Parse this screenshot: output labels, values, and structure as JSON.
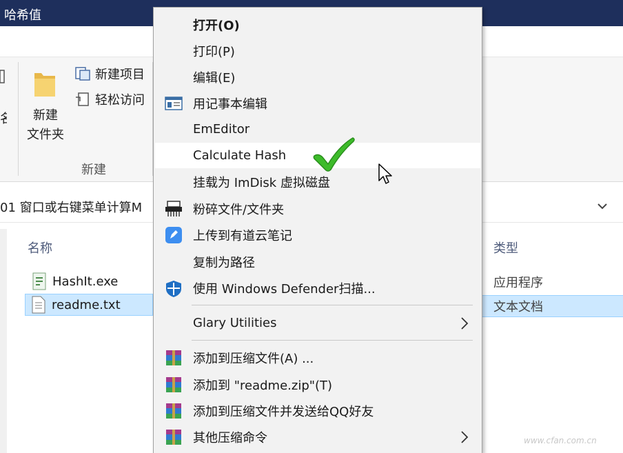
{
  "window": {
    "title": "哈希值"
  },
  "ribbon": {
    "new_folder_label_line1": "新建",
    "new_folder_label_line2": "文件夹",
    "new_item_label": "新建项目",
    "easy_access_label": "轻松访问",
    "group_label": "新建",
    "clipped_text_1": "名"
  },
  "address_bar": {
    "path_text": "01 窗口或右键菜单计算M"
  },
  "file_list": {
    "columns": {
      "name": "名称",
      "type": "类型"
    },
    "rows": [
      {
        "name": "HashIt.exe",
        "type": "应用程序",
        "icon": "exe-icon",
        "selected": false
      },
      {
        "name": "readme.txt",
        "type": "文本文档",
        "icon": "txt-file-icon",
        "selected": true
      }
    ]
  },
  "context_menu": {
    "items": [
      {
        "label": "打开(O)",
        "bold": true
      },
      {
        "label": "打印(P)"
      },
      {
        "label": "编辑(E)"
      },
      {
        "label": "用记事本编辑",
        "icon": "notepad-icon"
      },
      {
        "label": "EmEditor"
      },
      {
        "label": "Calculate Hash",
        "highlighted": true
      },
      {
        "label": "挂载为 ImDisk 虚拟磁盘"
      },
      {
        "label": "粉碎文件/文件夹",
        "icon": "shredder-icon"
      },
      {
        "label": "上传到有道云笔记",
        "icon": "youdao-note-icon"
      },
      {
        "label": "复制为路径"
      },
      {
        "label": "使用 Windows Defender扫描...",
        "icon": "defender-shield-icon"
      },
      {
        "label": "Glary Utilities",
        "submenu": true
      },
      {
        "label": "添加到压缩文件(A) ...",
        "icon": "winrar-icon"
      },
      {
        "label": "添加到 \"readme.zip\"(T)",
        "icon": "winrar-icon"
      },
      {
        "label": "添加到压缩文件并发送给QQ好友",
        "icon": "winrar-icon"
      },
      {
        "label": "其他压缩命令",
        "icon": "winrar-icon",
        "submenu": true
      }
    ]
  },
  "watermark": "www.cfan.com.cn",
  "colors": {
    "titlebar": "#1e2f5c",
    "selection": "#cce8ff",
    "menu_bg": "#f2f2f2",
    "check_green": "#3dbb2a"
  }
}
